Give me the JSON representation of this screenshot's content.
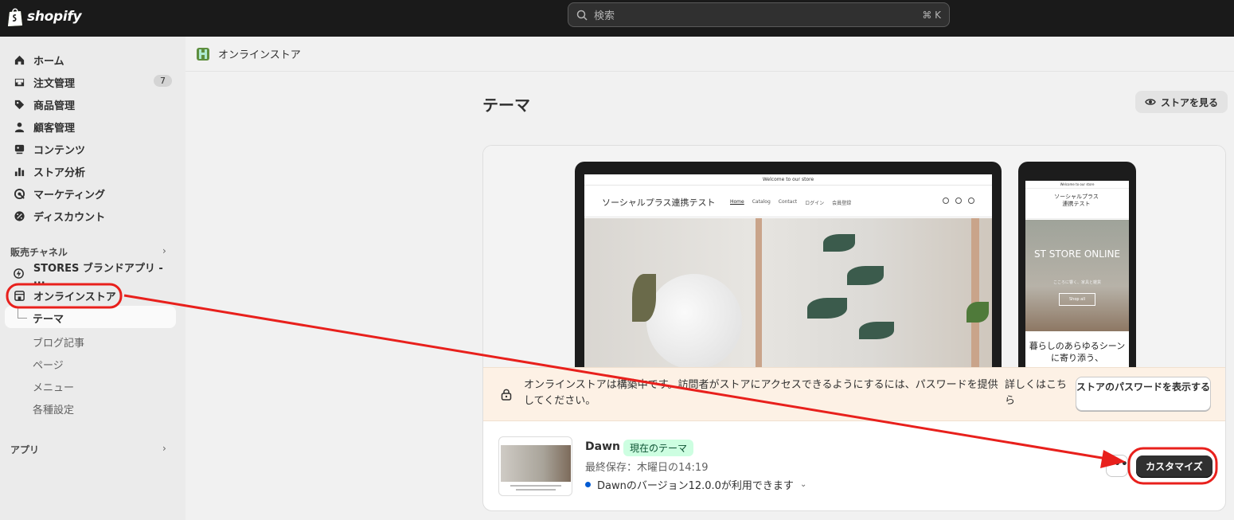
{
  "topbar": {
    "logo_text": "shopify",
    "search_placeholder": "検索",
    "search_shortcut": "⌘ K"
  },
  "sidebar": {
    "items": [
      {
        "label": "ホーム",
        "icon": "home-icon"
      },
      {
        "label": "注文管理",
        "icon": "inbox-icon",
        "badge": "7"
      },
      {
        "label": "商品管理",
        "icon": "tag-icon"
      },
      {
        "label": "顧客管理",
        "icon": "person-icon"
      },
      {
        "label": "コンテンツ",
        "icon": "content-icon"
      },
      {
        "label": "ストア分析",
        "icon": "bar-chart-icon"
      },
      {
        "label": "マーケティング",
        "icon": "target-icon"
      },
      {
        "label": "ディスカウント",
        "icon": "discount-icon"
      }
    ],
    "sales_channels_label": "販売チャネル",
    "channels": [
      {
        "label": "STORES ブランドアプリ - ...",
        "icon": "app-icon"
      },
      {
        "label": "オンラインストア",
        "icon": "store-icon"
      }
    ],
    "sub_items": {
      "active": "テーマ",
      "others": [
        "ブログ記事",
        "ページ",
        "メニュー",
        "各種設定"
      ]
    },
    "apps_label": "アプリ"
  },
  "header": {
    "breadcrumb": "オンラインストア",
    "page_title": "テーマ",
    "view_store_label": "ストアを見る"
  },
  "preview": {
    "desktop": {
      "announcement": "Welcome to our store",
      "brand": "ソーシャルプラス連携テスト",
      "menu": [
        "Home",
        "Catalog",
        "Contact",
        "ログイン",
        "会員登録"
      ]
    },
    "mobile": {
      "announcement": "Welcome to our store",
      "brand": "ソーシャルプラス連携テスト",
      "hero_title": "ST STORE ONLINE",
      "hero_sub": "こころに響く、家具と雑貨",
      "hero_button": "Shop all",
      "text": "暮らしのあらゆるシーンに寄り添う、"
    }
  },
  "notice": {
    "text": "オンラインストアは構築中です。訪問者がストアにアクセスできるようにするには、パスワードを提供してください。",
    "link": "詳しくはこちら",
    "button": "ストアのパスワードを表示する"
  },
  "theme": {
    "name": "Dawn",
    "badge": "現在のテーマ",
    "saved": "最終保存：木曜日の14:19",
    "update": "Dawnのバージョン12.0.0が利用できます",
    "more_label": "•••",
    "customize_label": "カスタマイズ"
  },
  "colors": {
    "topbar": "#1a1a1a",
    "sidebar": "#ebebeb",
    "badge_success_bg": "#cdfee1",
    "notice_bg": "#fdf1e5",
    "annotation": "#e8201c"
  }
}
